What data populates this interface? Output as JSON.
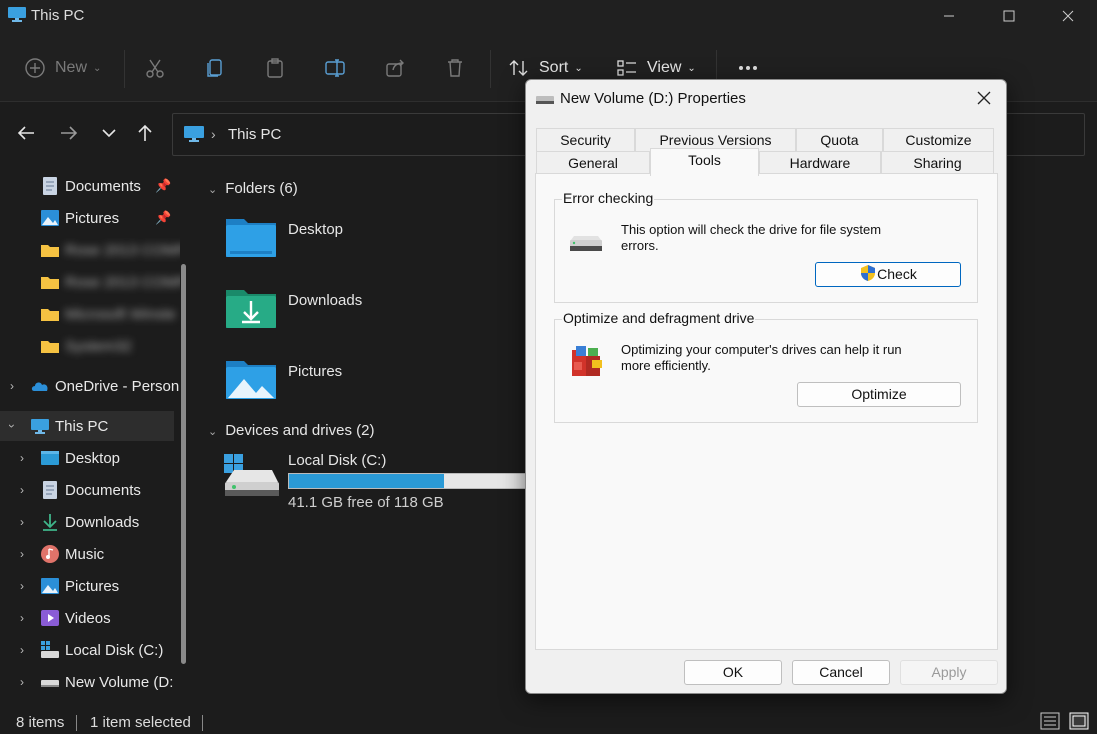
{
  "window": {
    "title": "This PC"
  },
  "toolbar": {
    "new_label": "New",
    "sort_label": "Sort",
    "view_label": "View"
  },
  "address": {
    "path": "This PC"
  },
  "sidebar": {
    "quick": [
      {
        "label": "Documents"
      },
      {
        "label": "Pictures"
      },
      {
        "label": "Rose 2013 COMPR"
      },
      {
        "label": "Rose 2013 COMPR"
      },
      {
        "label": "Microsoft Winste"
      },
      {
        "label": "System32"
      }
    ],
    "onedrive": "OneDrive - Person",
    "thispc": "This PC",
    "thispc_children": [
      {
        "label": "Desktop"
      },
      {
        "label": "Documents"
      },
      {
        "label": "Downloads"
      },
      {
        "label": "Music"
      },
      {
        "label": "Pictures"
      },
      {
        "label": "Videos"
      },
      {
        "label": "Local Disk (C:)"
      },
      {
        "label": "New Volume (D:"
      }
    ]
  },
  "content": {
    "folders_header": "Folders (6)",
    "folders": [
      {
        "label": "Desktop"
      },
      {
        "label": "Downloads"
      },
      {
        "label": "Pictures"
      }
    ],
    "drives_header": "Devices and drives (2)",
    "drives": [
      {
        "label": "Local Disk (C:)",
        "free_text": "41.1 GB free of 118 GB",
        "used_fraction": 0.652
      }
    ]
  },
  "statusbar": {
    "items": "8 items",
    "selected": "1 item selected"
  },
  "dialog": {
    "title": "New Volume (D:) Properties",
    "tabs_row1": [
      "Security",
      "Previous Versions",
      "Quota",
      "Customize"
    ],
    "tabs_row2": [
      "General",
      "Tools",
      "Hardware",
      "Sharing"
    ],
    "active_tab": "Tools",
    "error_checking": {
      "legend": "Error checking",
      "description": "This option will check the drive for file system errors.",
      "button": "Check"
    },
    "optimize": {
      "legend": "Optimize and defragment drive",
      "description": "Optimizing your computer's drives can help it run more efficiently.",
      "button": "Optimize"
    },
    "ok": "OK",
    "cancel": "Cancel",
    "apply": "Apply"
  },
  "colors": {
    "accent": "#2b9ad6",
    "window_bg": "#1c1c1c",
    "dialog_bg": "#f0f0f0"
  }
}
